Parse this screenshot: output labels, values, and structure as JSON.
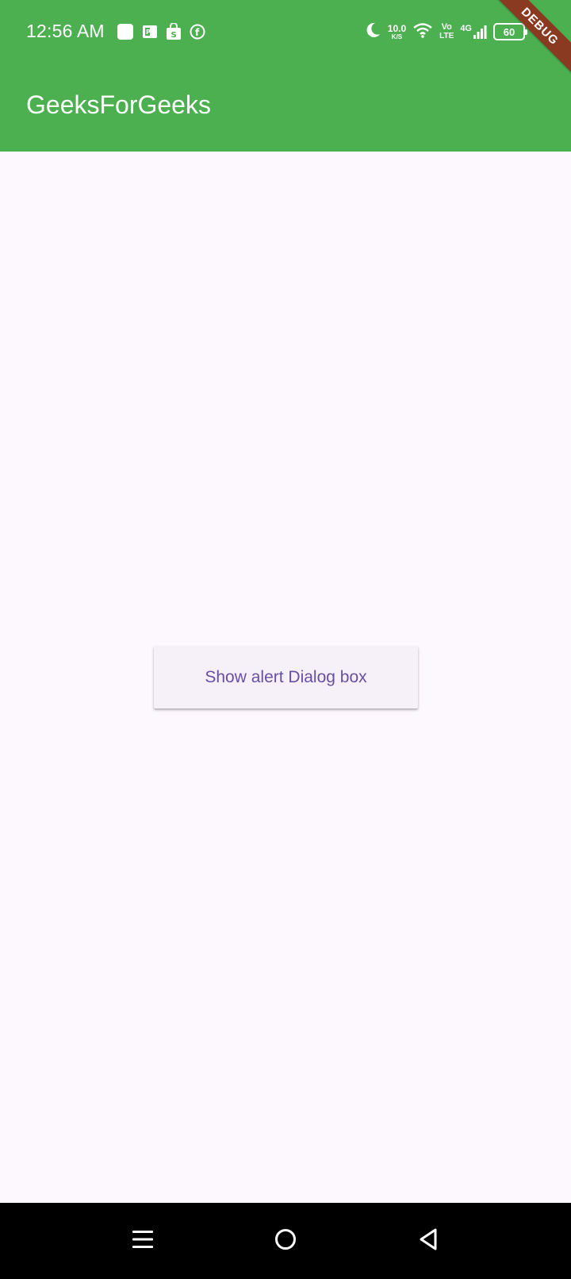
{
  "status_bar": {
    "time": "12:56 AM",
    "notification_icons": [
      "square-app-icon",
      "powerpoint-icon",
      "shopping-bag-icon",
      "facebook-icon"
    ],
    "net_speed_value": "10.0",
    "net_speed_unit": "K/S",
    "volte_top": "Vo",
    "volte_bottom": "LTE",
    "network_type": "4G",
    "battery_level": "60"
  },
  "app_bar": {
    "title": "GeeksForGeeks",
    "color": "#4caf50"
  },
  "debug_banner": {
    "label": "DEBUG",
    "color": "#8b3a22"
  },
  "body": {
    "show_dialog_button_label": "Show alert Dialog box",
    "button_text_color": "#6750a4",
    "background_color": "#fdf7fe"
  },
  "nav_bar": {
    "buttons": [
      "menu-icon",
      "home-icon",
      "back-icon"
    ]
  }
}
